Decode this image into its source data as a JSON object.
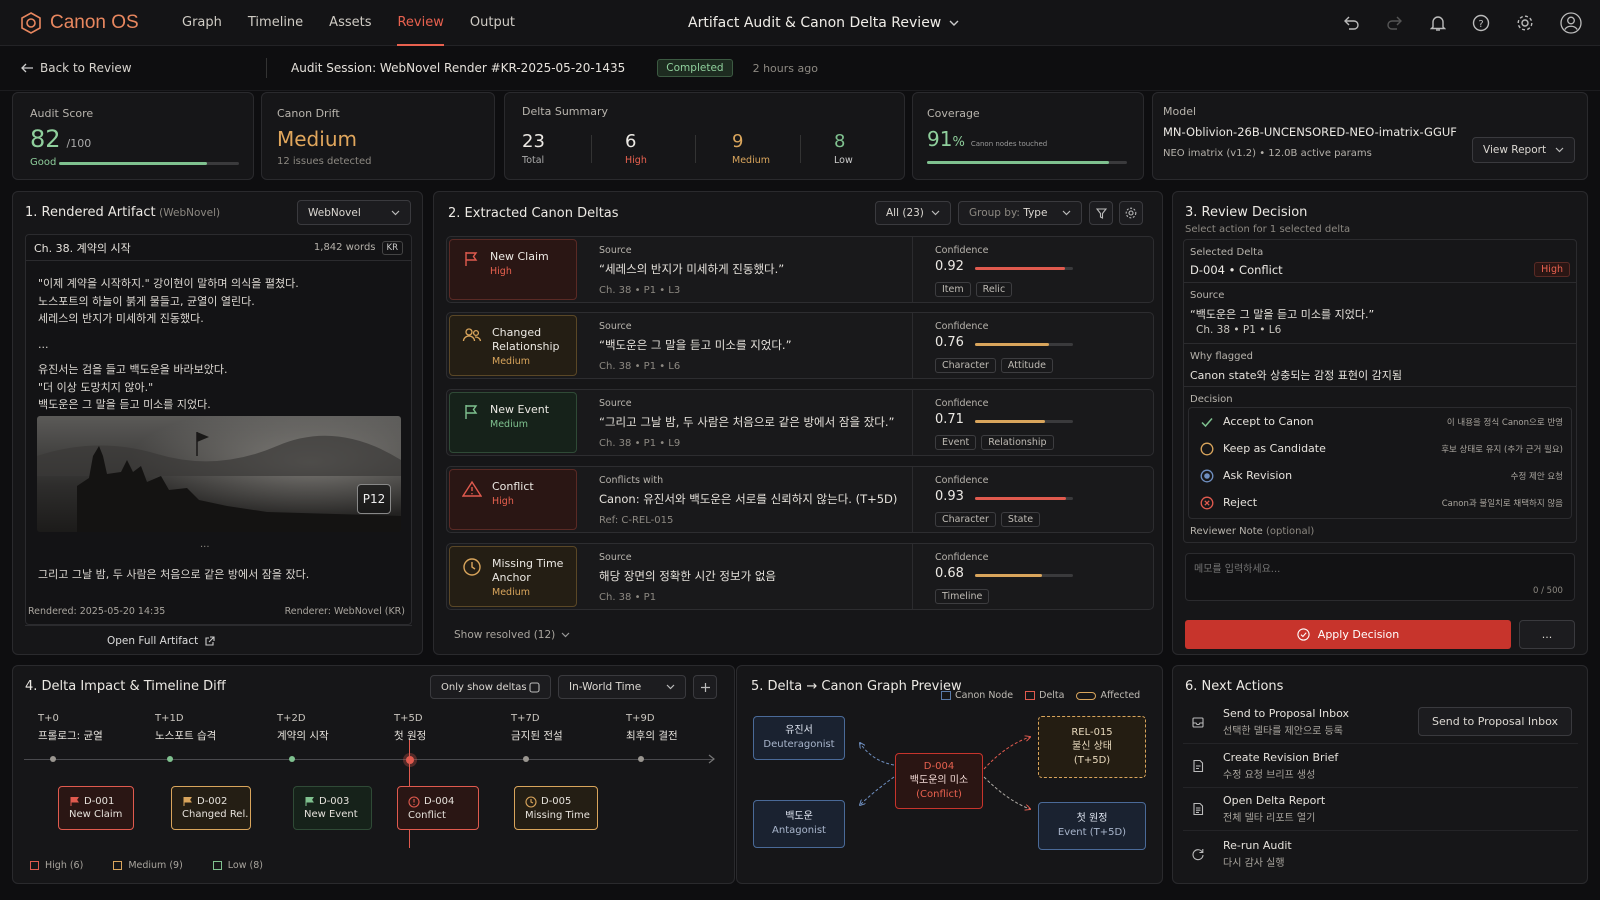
{
  "app": {
    "name": "Canon OS",
    "nav": [
      "Graph",
      "Timeline",
      "Assets",
      "Review",
      "Output"
    ],
    "active_nav": "Review",
    "title": "Artifact Audit & Canon Delta Review"
  },
  "sub": {
    "back": "Back to Review",
    "session": "Audit Session: WebNovel Render #KR-2025-05-20-1435",
    "status": "Completed",
    "time": "2 hours ago"
  },
  "stats": {
    "audit": {
      "label": "Audit Score",
      "value": "82",
      "suffix": "/100",
      "grade": "Good",
      "progress": 0.82
    },
    "drift": {
      "label": "Canon Drift",
      "value": "Medium",
      "detail": "12 issues detected"
    },
    "delta": {
      "label": "Delta Summary",
      "items": [
        {
          "value": "23",
          "label": "Total"
        },
        {
          "value": "6",
          "label": "High"
        },
        {
          "value": "9",
          "label": "Medium"
        },
        {
          "value": "8",
          "label": "Low"
        }
      ]
    },
    "coverage": {
      "label": "Coverage",
      "value": "91",
      "unit": "%",
      "detail": "Canon nodes touched",
      "progress": 0.91
    },
    "model": {
      "label": "Model",
      "name": "MN-Oblivion-26B-UNCENSORED-NEO-imatrix-GGUF",
      "detail": "NEO imatrix (v1.2) • 12.0B active params",
      "button": "View Report"
    }
  },
  "artifact": {
    "title": "1. Rendered Artifact",
    "subtitle": "(WebNovel)",
    "select": "WebNovel",
    "chapter": "Ch. 38. 계약의 시작",
    "words": "1,842 words",
    "lang": "KR",
    "lines": [
      "\"이제 계약을 시작하지.\" 강이현이 말하며 의식을 펼쳤다.",
      "노스포트의 하늘이 붉게 물들고, 균열이 열린다.",
      "세레스의 반지가 미세하게 진동했다.",
      "...",
      "유진서는 검을 들고 백도운을 바라보았다.",
      "\"더 이상 도망치지 않아.\"",
      "백도운은 그 말을 듣고 미소를 지었다."
    ],
    "image_tag": "P12",
    "ellipsis": "...",
    "last_line": "그리고 그날 밤, 두 사람은 처음으로 같은 방에서 잠을 잤다.",
    "rendered": "Rendered: 2025-05-20 14:35",
    "renderer": "Renderer: WebNovel (KR)",
    "open": "Open Full Artifact"
  },
  "deltas": {
    "title": "2. Extracted Canon Deltas",
    "filter": "All (23)",
    "group_label": "Group by:",
    "group_value": "Type",
    "show_resolved": "Show resolved (12)",
    "rows": [
      {
        "type": "New Claim",
        "sev": "High",
        "src_label": "Source",
        "quote": "“세레스의 반지가 미세하게 진동했다.”",
        "ref": "Ch. 38 • P1 • L3",
        "conf_label": "Confidence",
        "conf": "0.92",
        "confv": 0.92,
        "chips": [
          "Item",
          "Relic"
        ]
      },
      {
        "type": "Changed Relationship",
        "sev": "Medium",
        "src_label": "Source",
        "quote": "“백도운은 그 말을 듣고 미소를 지었다.”",
        "ref": "Ch. 38 • P1 • L6",
        "conf_label": "Confidence",
        "conf": "0.76",
        "confv": 0.76,
        "chips": [
          "Character",
          "Attitude"
        ]
      },
      {
        "type": "New Event",
        "sev": "Medium",
        "src_label": "Source",
        "quote": "“그리고 그날 밤, 두 사람은 처음으로 같은 방에서 잠을 잤다.”",
        "ref": "Ch. 38 • P1 • L9",
        "conf_label": "Confidence",
        "conf": "0.71",
        "confv": 0.71,
        "chips": [
          "Event",
          "Relationship"
        ]
      },
      {
        "type": "Conflict",
        "sev": "High",
        "src_label": "Conflicts with",
        "quote": "Canon: 유진서와 백도운은 서로를 신뢰하지 않는다. (T+5D)",
        "ref": "Ref: C-REL-015",
        "conf_label": "Confidence",
        "conf": "0.93",
        "confv": 0.93,
        "chips": [
          "Character",
          "State"
        ]
      },
      {
        "type": "Missing Time Anchor",
        "sev": "Medium",
        "src_label": "Source",
        "quote": "해당 장면의 정확한 시간 정보가 없음",
        "ref": "Ch. 38 • P1",
        "conf_label": "Confidence",
        "conf": "0.68",
        "confv": 0.68,
        "chips": [
          "Timeline"
        ]
      }
    ]
  },
  "decision": {
    "title": "3. Review Decision",
    "subtitle": "Select action for 1 selected delta",
    "sel_label": "Selected Delta",
    "sel_value": "D-004 • Conflict",
    "sel_badge": "High",
    "src_label": "Source",
    "src_quote": "“백도운은 그 말을 듣고 미소를 지었다.”",
    "src_ref": "Ch. 38 • P1 • L6",
    "why_label": "Why flagged",
    "why": "Canon state와 상충되는 감정 표현이 감지됨",
    "dec_label": "Decision",
    "options": [
      {
        "label": "Accept to Canon",
        "hint": "이 내용을 정식 Canon으로 반영"
      },
      {
        "label": "Keep as Candidate",
        "hint": "후보 상태로 유지 (추가 근거 필요)"
      },
      {
        "label": "Ask Revision",
        "hint": "수정 제안 요청"
      },
      {
        "label": "Reject",
        "hint": "Canon과 불일치로 채택하지 않음"
      }
    ],
    "note_label": "Reviewer Note",
    "note_opt": "(optional)",
    "note_placeholder": "메모를 입력하세요...",
    "note_count": "0 / 500",
    "apply": "Apply Decision",
    "more": "..."
  },
  "impact": {
    "title": "4. Delta Impact & Timeline Diff",
    "toggle": "Only show deltas",
    "time_select": "In-World Time",
    "ticks": [
      {
        "t": "T+0",
        "name": "프롤로그: 균열"
      },
      {
        "t": "T+1D",
        "name": "노스포트 습격"
      },
      {
        "t": "T+2D",
        "name": "계약의 시작"
      },
      {
        "t": "T+5D",
        "name": "첫 원정"
      },
      {
        "t": "T+7D",
        "name": "금지된 전설"
      },
      {
        "t": "T+9D",
        "name": "최후의 결전"
      }
    ],
    "nodes": [
      {
        "id": "D-001",
        "label": "New Claim"
      },
      {
        "id": "D-002",
        "label": "Changed Rel."
      },
      {
        "id": "D-003",
        "label": "New Event"
      },
      {
        "id": "D-004",
        "label": "Conflict"
      },
      {
        "id": "D-005",
        "label": "Missing Time"
      }
    ],
    "legend": [
      "High (6)",
      "Medium (9)",
      "Low (8)"
    ]
  },
  "graph": {
    "title": "5. Delta → Canon Graph Preview",
    "legend": [
      "Canon Node",
      "Delta",
      "Affected"
    ],
    "n1": {
      "name": "유진서",
      "role": "Deuteragonist"
    },
    "n2": {
      "name": "백도운",
      "role": "Antagonist"
    },
    "d": {
      "id": "D-004",
      "text": "백도운의 미소",
      "kind": "(Conflict)"
    },
    "r": {
      "id": "REL-015",
      "text": "불신 상태",
      "t": "(T+5D)"
    },
    "e": {
      "name": "첫 원정",
      "t": "Event (T+5D)"
    }
  },
  "next": {
    "title": "6. Next Actions",
    "items": [
      {
        "title": "Send to Proposal Inbox",
        "desc": "선택한 델타를 제안으로 등록",
        "button": "Send to Proposal Inbox"
      },
      {
        "title": "Create Revision Brief",
        "desc": "수정 요청 브리프 생성"
      },
      {
        "title": "Open Delta Report",
        "desc": "전체 델타 리포트 열기"
      },
      {
        "title": "Re-run Audit",
        "desc": "다시 감사 실행"
      }
    ]
  },
  "colors": {
    "accent": "#e8614f",
    "high": "#e05a4e",
    "medium": "#d9a55c",
    "low": "#7fc18f",
    "bg": "#0e0e10"
  }
}
